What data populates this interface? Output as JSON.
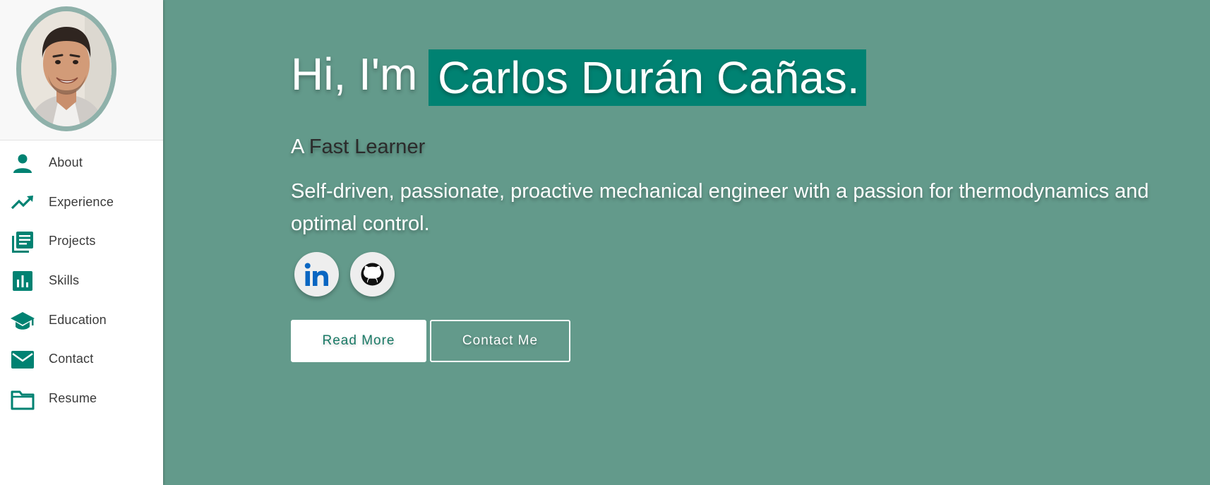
{
  "sidebar": {
    "items": [
      {
        "label": "About",
        "icon": "person-icon"
      },
      {
        "label": "Experience",
        "icon": "trending-up-icon"
      },
      {
        "label": "Projects",
        "icon": "library-books-icon"
      },
      {
        "label": "Skills",
        "icon": "bar-chart-icon"
      },
      {
        "label": "Education",
        "icon": "school-icon"
      },
      {
        "label": "Contact",
        "icon": "mail-icon"
      },
      {
        "label": "Resume",
        "icon": "folder-icon"
      }
    ]
  },
  "hero": {
    "greeting": "Hi, I'm",
    "name": "Carlos Durán Cañas.",
    "tagline_prefix": "A",
    "tagline_role": "Fast Learner",
    "description": "Self-driven, passionate, proactive mechanical engineer with a passion for thermodynamics and optimal control.",
    "social": [
      {
        "icon": "linkedin-icon"
      },
      {
        "icon": "github-icon"
      }
    ],
    "read_more_label": "Read More",
    "contact_label": "Contact Me"
  },
  "colors": {
    "background": "#639a8b",
    "accent": "#008272",
    "sidebar_icon": "#008272",
    "avatar_ring": "#8fb1aa"
  }
}
